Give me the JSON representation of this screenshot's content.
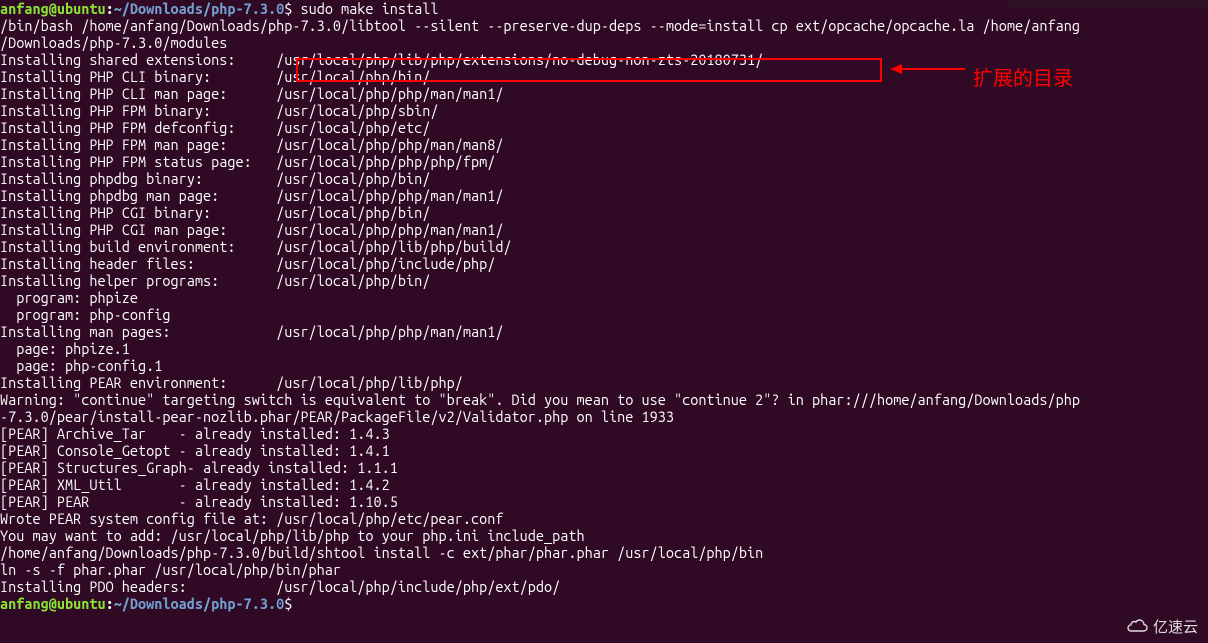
{
  "prompt": {
    "user": "anfang@ubuntu",
    "colon": ":",
    "path": "~/Downloads/php-7.3.0",
    "command": "$ sudo make install"
  },
  "lines": [
    "/bin/bash /home/anfang/Downloads/php-7.3.0/libtool --silent --preserve-dup-deps --mode=install cp ext/opcache/opcache.la /home/anfang",
    "/Downloads/php-7.3.0/modules",
    "Installing shared extensions:     /usr/local/php/lib/php/extensions/no-debug-non-zts-20180731/",
    "Installing PHP CLI binary:        /usr/local/php/bin/",
    "Installing PHP CLI man page:      /usr/local/php/php/man/man1/",
    "Installing PHP FPM binary:        /usr/local/php/sbin/",
    "Installing PHP FPM defconfig:     /usr/local/php/etc/",
    "Installing PHP FPM man page:      /usr/local/php/php/man/man8/",
    "Installing PHP FPM status page:   /usr/local/php/php/php/fpm/",
    "Installing phpdbg binary:         /usr/local/php/bin/",
    "Installing phpdbg man page:       /usr/local/php/php/man/man1/",
    "Installing PHP CGI binary:        /usr/local/php/bin/",
    "Installing PHP CGI man page:      /usr/local/php/php/man/man1/",
    "Installing build environment:     /usr/local/php/lib/php/build/",
    "Installing header files:          /usr/local/php/include/php/",
    "Installing helper programs:       /usr/local/php/bin/",
    "  program: phpize",
    "  program: php-config",
    "Installing man pages:             /usr/local/php/php/man/man1/",
    "  page: phpize.1",
    "  page: php-config.1",
    "Installing PEAR environment:      /usr/local/php/lib/php/",
    "",
    "Warning: \"continue\" targeting switch is equivalent to \"break\". Did you mean to use \"continue 2\"? in phar:///home/anfang/Downloads/php",
    "-7.3.0/pear/install-pear-nozlib.phar/PEAR/PackageFile/v2/Validator.php on line 1933",
    "[PEAR] Archive_Tar    - already installed: 1.4.3",
    "[PEAR] Console_Getopt - already installed: 1.4.1",
    "[PEAR] Structures_Graph- already installed: 1.1.1",
    "[PEAR] XML_Util       - already installed: 1.4.2",
    "[PEAR] PEAR           - already installed: 1.10.5",
    "Wrote PEAR system config file at: /usr/local/php/etc/pear.conf",
    "You may want to add: /usr/local/php/lib/php to your php.ini include_path",
    "/home/anfang/Downloads/php-7.3.0/build/shtool install -c ext/phar/phar.phar /usr/local/php/bin",
    "ln -s -f phar.phar /usr/local/php/bin/phar",
    "Installing PDO headers:           /usr/local/php/include/php/ext/pdo/"
  ],
  "prompt2": {
    "user": "anfang@ubuntu",
    "colon": ":",
    "path": "~/Downloads/php-7.3.0",
    "dollar": "$"
  },
  "annotation": "扩展的目录",
  "watermark": "亿速云"
}
